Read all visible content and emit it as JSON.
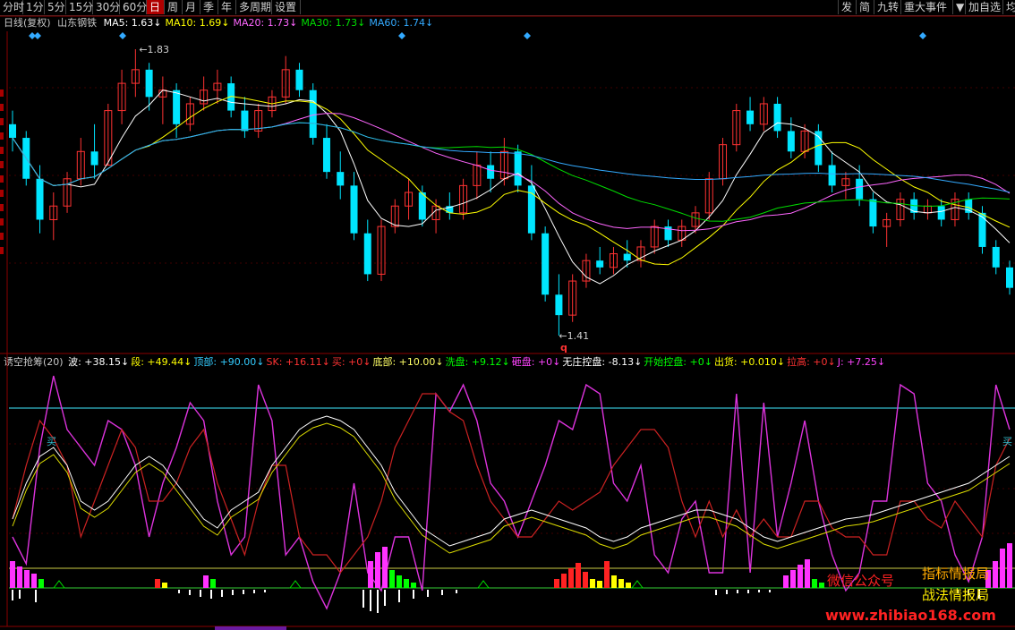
{
  "toolbar": {
    "periods": [
      "分时",
      "1分",
      "5分",
      "15分",
      "30分",
      "60分",
      "日",
      "周",
      "月",
      "季",
      "年",
      "多周期",
      "设置"
    ],
    "active_period": "日",
    "right_buttons": [
      "发",
      "简",
      "九转",
      "重大事件",
      "▼",
      "加自选",
      "均"
    ]
  },
  "main_header": {
    "label": "日线(复权)",
    "stock": "山东钢铁",
    "ma": [
      {
        "name": "MA5",
        "value": "1.63",
        "color": "#ffffff"
      },
      {
        "name": "MA10",
        "value": "1.69",
        "color": "#ffff00"
      },
      {
        "name": "MA20",
        "value": "1.73",
        "color": "#ff66ff"
      },
      {
        "name": "MA30",
        "value": "1.73",
        "color": "#00dd00"
      },
      {
        "name": "MA60",
        "value": "1.74",
        "color": "#33aaff"
      }
    ]
  },
  "price_annotations": {
    "high": "1.83",
    "low": "1.41",
    "marker": "q"
  },
  "indicator_header": {
    "title": "诱空抢筹(20)",
    "items": [
      {
        "label": "波",
        "value": "+38.15",
        "color": "#ffffff"
      },
      {
        "label": "段",
        "value": "+49.44",
        "color": "#ffff00"
      },
      {
        "label": "顶部",
        "value": "+90.00",
        "color": "#33ccff"
      },
      {
        "label": "SK",
        "value": "+16.11",
        "color": "#ff3333"
      },
      {
        "label": "买",
        "value": "+0",
        "color": "#ff3333"
      },
      {
        "label": "底部",
        "value": "+10.00",
        "color": "#ffff66"
      },
      {
        "label": "洗盘",
        "value": "+9.12",
        "color": "#00ff00"
      },
      {
        "label": "砸盘",
        "value": "+0",
        "color": "#ff44ff"
      },
      {
        "label": "无庄控盘",
        "value": "-8.13",
        "color": "#ffffff"
      },
      {
        "label": "开始控盘",
        "value": "+0",
        "color": "#00ff00"
      },
      {
        "label": "出货",
        "value": "+0.010",
        "color": "#ffff00"
      },
      {
        "label": "拉高",
        "value": "+0",
        "color": "#ff3333"
      },
      {
        "label": "J",
        "value": "+7.25",
        "color": "#ff44ff"
      }
    ]
  },
  "indicator_marks": {
    "buy": "买"
  },
  "watermark": {
    "wechat": "微信公众号",
    "name1": "指标情报局",
    "name2": "战法情报局",
    "url": "www.zhibiao168.com"
  },
  "chart_data": {
    "type": "candlestick",
    "price_range": [
      1.41,
      1.83
    ],
    "candles": [
      [
        1.72,
        1.74,
        1.68,
        1.7
      ],
      [
        1.7,
        1.71,
        1.63,
        1.64
      ],
      [
        1.64,
        1.66,
        1.56,
        1.58
      ],
      [
        1.58,
        1.62,
        1.55,
        1.6
      ],
      [
        1.6,
        1.65,
        1.59,
        1.64
      ],
      [
        1.64,
        1.7,
        1.63,
        1.68
      ],
      [
        1.68,
        1.72,
        1.64,
        1.66
      ],
      [
        1.66,
        1.75,
        1.66,
        1.74
      ],
      [
        1.74,
        1.8,
        1.72,
        1.78
      ],
      [
        1.78,
        1.83,
        1.76,
        1.8
      ],
      [
        1.8,
        1.81,
        1.74,
        1.76
      ],
      [
        1.76,
        1.79,
        1.72,
        1.77
      ],
      [
        1.77,
        1.78,
        1.7,
        1.72
      ],
      [
        1.72,
        1.76,
        1.71,
        1.75
      ],
      [
        1.75,
        1.79,
        1.74,
        1.77
      ],
      [
        1.77,
        1.8,
        1.75,
        1.78
      ],
      [
        1.78,
        1.79,
        1.73,
        1.74
      ],
      [
        1.74,
        1.76,
        1.7,
        1.71
      ],
      [
        1.71,
        1.75,
        1.7,
        1.74
      ],
      [
        1.74,
        1.77,
        1.73,
        1.76
      ],
      [
        1.76,
        1.82,
        1.75,
        1.8
      ],
      [
        1.8,
        1.81,
        1.76,
        1.77
      ],
      [
        1.77,
        1.78,
        1.69,
        1.7
      ],
      [
        1.7,
        1.72,
        1.64,
        1.65
      ],
      [
        1.65,
        1.68,
        1.61,
        1.63
      ],
      [
        1.63,
        1.65,
        1.55,
        1.56
      ],
      [
        1.56,
        1.58,
        1.49,
        1.5
      ],
      [
        1.5,
        1.58,
        1.49,
        1.57
      ],
      [
        1.57,
        1.61,
        1.56,
        1.6
      ],
      [
        1.6,
        1.64,
        1.58,
        1.62
      ],
      [
        1.62,
        1.63,
        1.57,
        1.58
      ],
      [
        1.58,
        1.61,
        1.56,
        1.6
      ],
      [
        1.6,
        1.62,
        1.58,
        1.59
      ],
      [
        1.59,
        1.64,
        1.58,
        1.63
      ],
      [
        1.63,
        1.68,
        1.61,
        1.66
      ],
      [
        1.66,
        1.68,
        1.62,
        1.64
      ],
      [
        1.64,
        1.7,
        1.63,
        1.68
      ],
      [
        1.68,
        1.69,
        1.62,
        1.63
      ],
      [
        1.63,
        1.66,
        1.55,
        1.56
      ],
      [
        1.56,
        1.57,
        1.46,
        1.47
      ],
      [
        1.47,
        1.5,
        1.41,
        1.44
      ],
      [
        1.44,
        1.5,
        1.43,
        1.49
      ],
      [
        1.49,
        1.53,
        1.48,
        1.52
      ],
      [
        1.52,
        1.54,
        1.5,
        1.51
      ],
      [
        1.51,
        1.54,
        1.5,
        1.53
      ],
      [
        1.53,
        1.55,
        1.51,
        1.52
      ],
      [
        1.52,
        1.55,
        1.51,
        1.54
      ],
      [
        1.54,
        1.58,
        1.53,
        1.57
      ],
      [
        1.57,
        1.58,
        1.54,
        1.55
      ],
      [
        1.55,
        1.58,
        1.54,
        1.57
      ],
      [
        1.57,
        1.6,
        1.56,
        1.59
      ],
      [
        1.59,
        1.65,
        1.58,
        1.64
      ],
      [
        1.64,
        1.7,
        1.63,
        1.69
      ],
      [
        1.69,
        1.75,
        1.68,
        1.74
      ],
      [
        1.74,
        1.76,
        1.71,
        1.72
      ],
      [
        1.72,
        1.76,
        1.71,
        1.75
      ],
      [
        1.75,
        1.76,
        1.7,
        1.71
      ],
      [
        1.71,
        1.73,
        1.67,
        1.68
      ],
      [
        1.68,
        1.72,
        1.67,
        1.71
      ],
      [
        1.71,
        1.72,
        1.65,
        1.66
      ],
      [
        1.66,
        1.68,
        1.62,
        1.63
      ],
      [
        1.63,
        1.65,
        1.61,
        1.64
      ],
      [
        1.64,
        1.66,
        1.6,
        1.61
      ],
      [
        1.61,
        1.62,
        1.56,
        1.57
      ],
      [
        1.57,
        1.59,
        1.54,
        1.58
      ],
      [
        1.58,
        1.62,
        1.57,
        1.61
      ],
      [
        1.61,
        1.62,
        1.58,
        1.59
      ],
      [
        1.59,
        1.61,
        1.58,
        1.6
      ],
      [
        1.6,
        1.61,
        1.57,
        1.58
      ],
      [
        1.58,
        1.62,
        1.57,
        1.61
      ],
      [
        1.61,
        1.62,
        1.58,
        1.59
      ],
      [
        1.59,
        1.6,
        1.53,
        1.54
      ],
      [
        1.54,
        1.55,
        1.5,
        1.51
      ],
      [
        1.51,
        1.52,
        1.47,
        1.48
      ]
    ]
  }
}
